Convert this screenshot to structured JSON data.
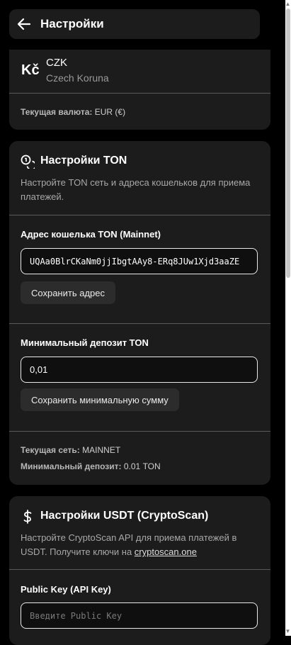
{
  "header": {
    "title": "Настройки",
    "back_icon": "arrow-left-icon"
  },
  "currency": {
    "symbol": "Kč",
    "code": "CZK",
    "name": "Czech Koruna",
    "current_label": "Текущая валюта:",
    "current_value": "EUR (€)"
  },
  "ton": {
    "icon": "coins-icon",
    "title": "Настройки TON",
    "description": "Настройте TON сеть и адреса кошельков для приема платежей.",
    "wallet_label": "Адрес кошелька TON (Mainnet)",
    "wallet_value": "UQAa0BlrCKaNm0jjIbgtAAy8-ERq8JUw1Xjd3aaZE",
    "save_address": "Сохранить адрес",
    "min_deposit_label": "Минимальный депозит TON",
    "min_deposit_value": "0,01",
    "save_min": "Сохранить минимальную сумму",
    "network_label": "Текущая сеть:",
    "network_value": "MAINNET",
    "min_info_label": "Минимальный депозит:",
    "min_info_value": "0.01 TON"
  },
  "usdt": {
    "icon": "dollar-icon",
    "title": "Настройки USDT (CryptoScan)",
    "description_prefix": "Настройте CryptoScan API для приема платежей в USDT. Получите ключи на ",
    "link_text": "cryptoscan.one",
    "public_key_label": "Public Key (API Key)",
    "public_key_placeholder": "Введите Public Key"
  }
}
